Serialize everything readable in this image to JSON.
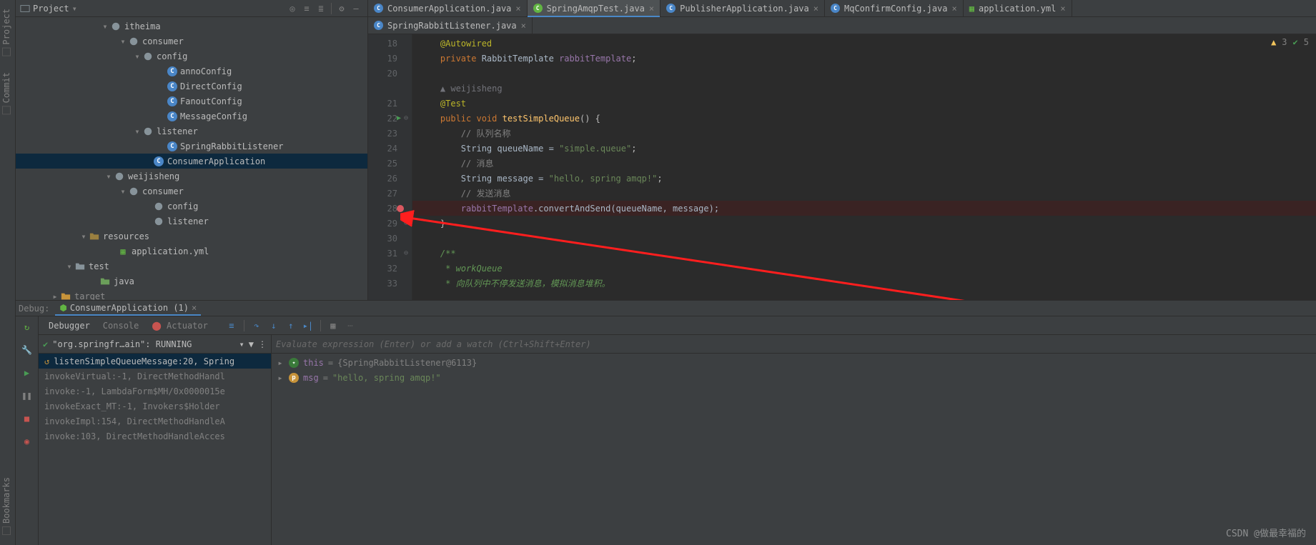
{
  "stripe": {
    "project": "Project",
    "commit": "Commit",
    "bookmarks": "Bookmarks"
  },
  "project_panel": {
    "title": "Project",
    "tree": [
      {
        "indent": 120,
        "arrow": "▾",
        "icon": "pkg",
        "label": "itheima"
      },
      {
        "indent": 145,
        "arrow": "▾",
        "icon": "pkg",
        "label": "consumer"
      },
      {
        "indent": 165,
        "arrow": "▾",
        "icon": "pkg",
        "label": "config"
      },
      {
        "indent": 200,
        "arrow": "",
        "icon": "class",
        "label": "annoConfig"
      },
      {
        "indent": 200,
        "arrow": "",
        "icon": "class",
        "label": "DirectConfig"
      },
      {
        "indent": 200,
        "arrow": "",
        "icon": "class",
        "label": "FanoutConfig"
      },
      {
        "indent": 200,
        "arrow": "",
        "icon": "class",
        "label": "MessageConfig"
      },
      {
        "indent": 165,
        "arrow": "▾",
        "icon": "pkg",
        "label": "listener"
      },
      {
        "indent": 200,
        "arrow": "",
        "icon": "class",
        "label": "SpringRabbitListener"
      },
      {
        "indent": 180,
        "arrow": "",
        "icon": "app",
        "label": "ConsumerApplication",
        "selected": true
      },
      {
        "indent": 125,
        "arrow": "▾",
        "icon": "pkg",
        "label": "weijisheng"
      },
      {
        "indent": 145,
        "arrow": "▾",
        "icon": "pkg",
        "label": "consumer"
      },
      {
        "indent": 180,
        "arrow": "",
        "icon": "pkg",
        "label": "config"
      },
      {
        "indent": 180,
        "arrow": "",
        "icon": "pkg",
        "label": "listener"
      },
      {
        "indent": 90,
        "arrow": "▾",
        "icon": "res",
        "label": "resources"
      },
      {
        "indent": 130,
        "arrow": "",
        "icon": "yml",
        "label": "application.yml"
      },
      {
        "indent": 70,
        "arrow": "▾",
        "icon": "folder",
        "label": "test"
      },
      {
        "indent": 105,
        "arrow": "",
        "icon": "folder-green",
        "label": "java"
      },
      {
        "indent": 50,
        "arrow": "▸",
        "icon": "folder-orange",
        "label": "target",
        "dim": true
      }
    ]
  },
  "tabs_top": [
    {
      "icon": "C",
      "label": "ConsumerApplication.java",
      "active": false
    },
    {
      "icon": "G",
      "label": "SpringAmqpTest.java",
      "active": true
    },
    {
      "icon": "C",
      "label": "PublisherApplication.java",
      "active": false
    },
    {
      "icon": "C",
      "label": "MqConfirmConfig.java",
      "active": false
    },
    {
      "icon": "Y",
      "label": "application.yml",
      "active": false
    }
  ],
  "tabs_sub": [
    {
      "icon": "C",
      "label": "SpringRabbitListener.java",
      "active": false
    }
  ],
  "status": {
    "warn": "3",
    "check": "5"
  },
  "code": {
    "lines": [
      {
        "n": "18",
        "tokens": [
          [
            "    ",
            ""
          ],
          [
            "@Autowired",
            "anno"
          ]
        ]
      },
      {
        "n": "19",
        "tokens": [
          [
            "    ",
            ""
          ],
          [
            "private ",
            "kw"
          ],
          [
            "RabbitTemplate ",
            "type"
          ],
          [
            "rabbitTemplate",
            "field"
          ],
          [
            ";",
            ""
          ]
        ]
      },
      {
        "n": "20",
        "tokens": [
          [
            "",
            ""
          ]
        ]
      },
      {
        "n": "",
        "tokens": [
          [
            "    ",
            ""
          ],
          [
            "▲ weijisheng",
            "auth"
          ]
        ]
      },
      {
        "n": "21",
        "tokens": [
          [
            "    ",
            ""
          ],
          [
            "@Test",
            "anno"
          ]
        ]
      },
      {
        "n": "22",
        "mark": "▶",
        "tog": "⊖",
        "tokens": [
          [
            "    ",
            ""
          ],
          [
            "public ",
            "kw"
          ],
          [
            "void ",
            "kw"
          ],
          [
            "testSimpleQueue",
            "method"
          ],
          [
            "() {",
            ""
          ]
        ]
      },
      {
        "n": "23",
        "tokens": [
          [
            "        ",
            ""
          ],
          [
            "// 队列名称",
            "cmt"
          ]
        ]
      },
      {
        "n": "24",
        "tokens": [
          [
            "        ",
            ""
          ],
          [
            "String queueName = ",
            "ident"
          ],
          [
            "\"simple.queue\"",
            "str"
          ],
          [
            ";",
            ""
          ]
        ]
      },
      {
        "n": "25",
        "tokens": [
          [
            "        ",
            ""
          ],
          [
            "// 消息",
            "cmt"
          ]
        ]
      },
      {
        "n": "26",
        "tokens": [
          [
            "        ",
            ""
          ],
          [
            "String message = ",
            "ident"
          ],
          [
            "\"hello, spring amqp!\"",
            "str"
          ],
          [
            ";",
            ""
          ]
        ]
      },
      {
        "n": "27",
        "tokens": [
          [
            "        ",
            ""
          ],
          [
            "// 发送消息",
            "cmt"
          ]
        ]
      },
      {
        "n": "28",
        "bp": true,
        "hl": true,
        "tokens": [
          [
            "        ",
            ""
          ],
          [
            "rabbitTemplate",
            "field"
          ],
          [
            ".convertAndSend(queueName, message);",
            "ident"
          ]
        ]
      },
      {
        "n": "29",
        "tog": "⊖",
        "tokens": [
          [
            "    }",
            ""
          ]
        ]
      },
      {
        "n": "30",
        "tokens": [
          [
            "",
            ""
          ]
        ]
      },
      {
        "n": "31",
        "tog": "⊖",
        "tokens": [
          [
            "    ",
            ""
          ],
          [
            "/**",
            "doc"
          ]
        ]
      },
      {
        "n": "32",
        "tokens": [
          [
            "     ",
            ""
          ],
          [
            "* workQueue",
            "doc"
          ]
        ]
      },
      {
        "n": "33",
        "tokens": [
          [
            "     ",
            ""
          ],
          [
            "* 向队列中不停发送消息，模拟消息堆积。",
            "doc"
          ]
        ]
      }
    ]
  },
  "debug": {
    "title": "Debug:",
    "run_config": "ConsumerApplication (1)",
    "tabs": {
      "debugger": "Debugger",
      "console": "Console",
      "actuator": "Actuator"
    },
    "thread": "\"org.springfr…ain\": RUNNING",
    "eval_placeholder": "Evaluate expression (Enter) or add a watch (Ctrl+Shift+Enter)",
    "frames": [
      {
        "text": "listenSimpleQueueMessage:20, Spring",
        "active": true,
        "icon": "↺"
      },
      {
        "text": "invokeVirtual:-1, DirectMethodHandl"
      },
      {
        "text": "invoke:-1, LambdaForm$MH/0x0000015e"
      },
      {
        "text": "invokeExact_MT:-1, Invokers$Holder"
      },
      {
        "text": "invokeImpl:154, DirectMethodHandleA"
      },
      {
        "text": "invoke:103, DirectMethodHandleAcces"
      }
    ],
    "vars": [
      {
        "caret": "▸",
        "ico": "t",
        "name": "this",
        "eq": " = ",
        "val": "{SpringRabbitListener@6113}"
      },
      {
        "caret": "▸",
        "ico": "p",
        "name": "msg",
        "eq": " = ",
        "val": "\"hello, spring amqp!\"",
        "is_str": true
      }
    ]
  },
  "watermark": "CSDN @做最幸福的"
}
